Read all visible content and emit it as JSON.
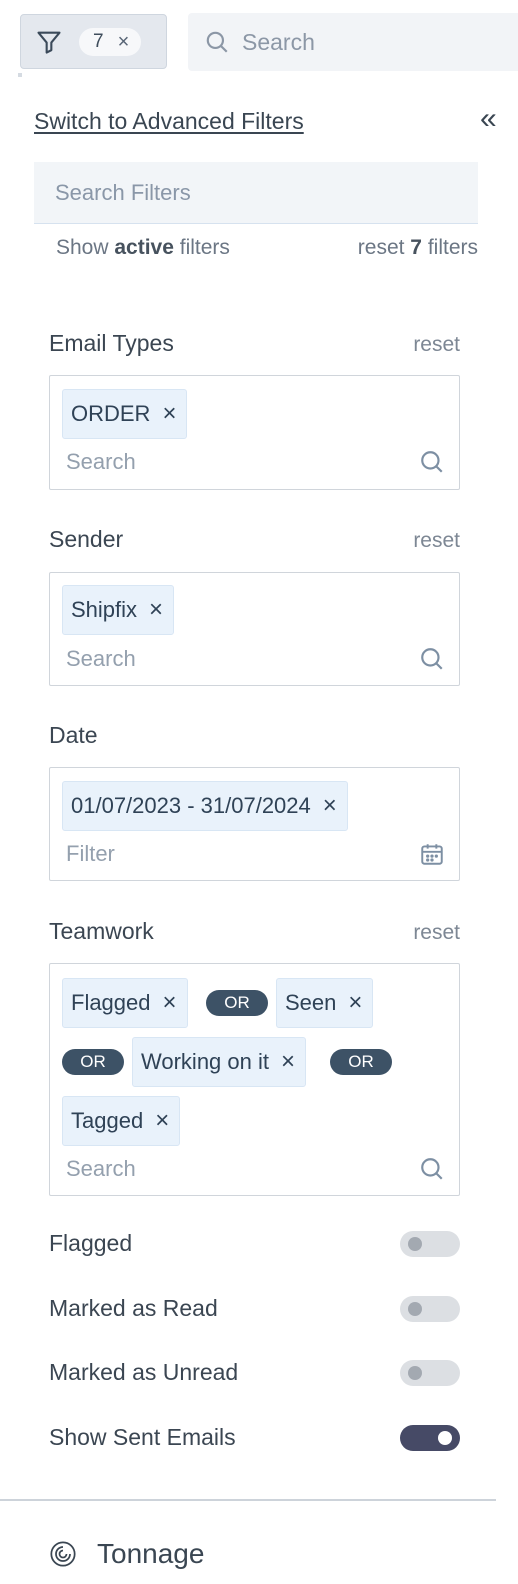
{
  "toolbar": {
    "filter_count": "7",
    "clear_symbol": "×",
    "search_placeholder": "Search"
  },
  "panel": {
    "advanced_link": "Switch to Advanced Filters",
    "collapse_symbol": "«",
    "search_filters_placeholder": "Search Filters",
    "show_prefix": "Show ",
    "show_bold": "active",
    "show_suffix": " filters",
    "reset_prefix": "reset ",
    "reset_count": "7",
    "reset_suffix": " filters"
  },
  "sections": {
    "email_types": {
      "title": "Email Types",
      "reset": "reset",
      "chips": [
        "ORDER"
      ],
      "input_placeholder": "Search"
    },
    "sender": {
      "title": "Sender",
      "reset": "reset",
      "chips": [
        "Shipfix"
      ],
      "input_placeholder": "Search"
    },
    "date": {
      "title": "Date",
      "chips": [
        "01/07/2023 - 31/07/2024"
      ],
      "input_placeholder": "Filter"
    },
    "teamwork": {
      "title": "Teamwork",
      "reset": "reset",
      "chips": [
        "Flagged",
        "Seen",
        "Working on it",
        "Tagged"
      ],
      "operator": "OR",
      "input_placeholder": "Search"
    }
  },
  "toggles": [
    {
      "label": "Flagged",
      "on": false
    },
    {
      "label": "Marked as Read",
      "on": false
    },
    {
      "label": "Marked as Unread",
      "on": false
    },
    {
      "label": "Show Sent Emails",
      "on": true
    }
  ],
  "tonnage": {
    "title": "Tonnage",
    "icon": "tonnage-icon"
  },
  "colors": {
    "chip_bg": "#e9f2fb",
    "or_badge": "#3d5266",
    "toggle_on": "#464a66"
  }
}
